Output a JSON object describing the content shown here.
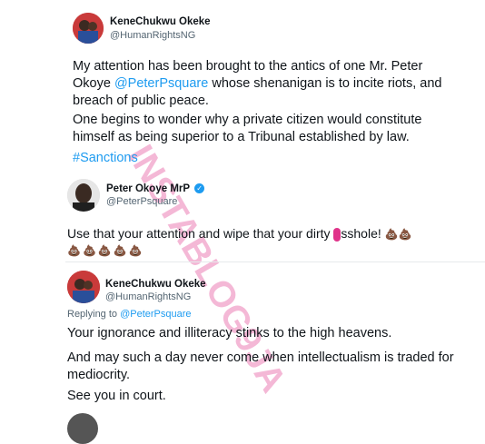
{
  "tweet1": {
    "name": "KeneChukwu Okeke",
    "handle": "@HumanRightsNG",
    "text_part1": "My attention has been brought to the antics of one Mr. Peter Okoye ",
    "mention": "@PeterPsquare",
    "text_part2": " whose shenanigan is to incite riots, and breach of public peace.",
    "text_para2": "One begins to wonder why a private citizen would constitute himself as being superior to a Tribunal established by law.",
    "hashtag": "#Sanctions"
  },
  "tweet2": {
    "name": "Peter Okoye MrP",
    "handle": "@PeterPsquare",
    "text_a": "Use that your attention and wipe that your dirty ",
    "text_b": "sshole!",
    "emoji": "💩",
    "emoji_line": "💩💩💩💩💩"
  },
  "tweet3": {
    "name": "KeneChukwu Okeke",
    "handle": "@HumanRightsNG",
    "replying_prefix": "Replying to ",
    "replying_to": "@PeterPsquare",
    "para1": "Your ignorance and illiteracy stinks to the high heavens.",
    "para2": "And may such a day never come when intellectualism is traded for mediocrity.",
    "para3": "See you in court."
  },
  "watermark": "INSTABLOG9JA",
  "colors": {
    "link": "#1d9bf0",
    "watermark": "#e0338a"
  }
}
